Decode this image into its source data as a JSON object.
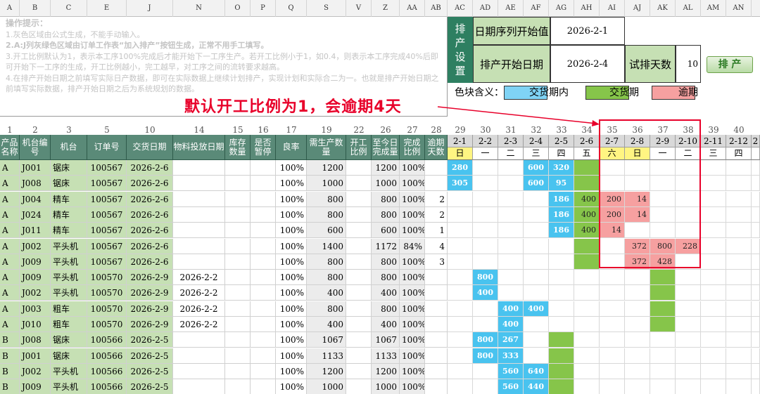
{
  "colors": {
    "blue": "#49c3ef",
    "green": "#86c54a",
    "red": "#f6a0a0",
    "yellow": "#fff582",
    "header_green": "#5a8a78"
  },
  "column_letters": [
    "A",
    "B",
    "C",
    "E",
    "J",
    "N",
    "O",
    "P",
    "Q",
    "S",
    "V",
    "Z",
    "AA",
    "AB",
    "AC",
    "AD",
    "AE",
    "AF",
    "AG",
    "AH",
    "AI",
    "AJ",
    "AK",
    "AL",
    "AM",
    "AN"
  ],
  "tips": {
    "title": "操作提示：",
    "l1": "1.灰色区域由公式生成，不能手动输入。",
    "l2": "2.A:J列灰绿色区域由订单工作表“加入排产”按钮生成，正常不用手工填写。",
    "l3": "3.开工比例默认为1，表示本工序100%完成后才能开始下一工序生产。若开工比例小于1，如0.4，则表示本工序完成40%后即可开始下一工序的生成，开工比例越小，完工越早，对工序之间的流转要求越高。",
    "l4": "4.在排产开始日期之前填写实际日产数据，即可在实际数据上继续计划排产，实现计划和实际合二为一。也就是排产开始日期之前填写实际数据，排产开始日期之后为系统规划的数据。"
  },
  "annotation": "默认开工比例为1，会逾期4天",
  "setup": {
    "label": "排产设置",
    "seq_start_label": "日期序列开始值",
    "seq_start_value": "2026-2-1",
    "sched_start_label": "排产开始日期",
    "sched_start_value": "2026-2-4",
    "trial_days_label": "试排天数",
    "trial_days_value": "10",
    "run_button": "排 产"
  },
  "legend": {
    "label": "色块含义：",
    "in_period": "交货期内",
    "due": "交货期",
    "overdue": "逾期"
  },
  "col_numbers": [
    "1",
    "2",
    "3",
    "5",
    "10",
    "14",
    "15",
    "16",
    "17",
    "19",
    "22",
    "26",
    "27",
    "28",
    "29",
    "30",
    "31",
    "32",
    "33",
    "34",
    "35",
    "36",
    "37",
    "38",
    "39",
    "40"
  ],
  "headers": {
    "product": "产品名称",
    "machine_no": "机台编号",
    "machine": "机台",
    "order": "订单号",
    "due_date": "交货日期",
    "material": "物料投放日期",
    "stock": "库存数量",
    "pause": "是否暂停",
    "yield": "良率",
    "need": "需生产数量",
    "ratio": "开工比例",
    "done": "至今日完成量",
    "done_pct": "完成比例",
    "overdue": "逾期天数"
  },
  "dates": [
    "2-1",
    "2-2",
    "2-3",
    "2-4",
    "2-5",
    "2-6",
    "2-7",
    "2-8",
    "2-9",
    "2-10",
    "2-11",
    "2-12",
    "2"
  ],
  "weekdays": [
    "日",
    "一",
    "二",
    "三",
    "四",
    "五",
    "六",
    "日",
    "一",
    "二",
    "三",
    "四",
    ""
  ],
  "rows": [
    {
      "p": "A",
      "no": "J001",
      "m": "锯床",
      "o": "100567",
      "d": "2026-2-6",
      "mat": "",
      "y": "100%",
      "n": "1200",
      "done": "1200",
      "pct": "100%",
      "od": ""
    },
    {
      "p": "A",
      "no": "J008",
      "m": "锯床",
      "o": "100567",
      "d": "2026-2-6",
      "mat": "",
      "y": "100%",
      "n": "1000",
      "done": "1000",
      "pct": "100%",
      "od": ""
    },
    {
      "p": "A",
      "no": "J004",
      "m": "精车",
      "o": "100567",
      "d": "2026-2-6",
      "mat": "",
      "y": "100%",
      "n": "800",
      "done": "800",
      "pct": "100%",
      "od": "2"
    },
    {
      "p": "A",
      "no": "J024",
      "m": "精车",
      "o": "100567",
      "d": "2026-2-6",
      "mat": "",
      "y": "100%",
      "n": "800",
      "done": "800",
      "pct": "100%",
      "od": "2"
    },
    {
      "p": "A",
      "no": "J011",
      "m": "精车",
      "o": "100567",
      "d": "2026-2-6",
      "mat": "",
      "y": "100%",
      "n": "600",
      "done": "600",
      "pct": "100%",
      "od": "1"
    },
    {
      "p": "A",
      "no": "J002",
      "m": "平头机",
      "o": "100567",
      "d": "2026-2-6",
      "mat": "",
      "y": "100%",
      "n": "1400",
      "done": "1172",
      "pct": "84%",
      "od": "4"
    },
    {
      "p": "A",
      "no": "J009",
      "m": "平头机",
      "o": "100567",
      "d": "2026-2-6",
      "mat": "",
      "y": "100%",
      "n": "800",
      "done": "800",
      "pct": "100%",
      "od": "3"
    },
    {
      "p": "A",
      "no": "J009",
      "m": "平头机",
      "o": "100570",
      "d": "2026-2-9",
      "mat": "2026-2-2",
      "y": "100%",
      "n": "800",
      "done": "800",
      "pct": "100%",
      "od": ""
    },
    {
      "p": "A",
      "no": "J002",
      "m": "平头机",
      "o": "100570",
      "d": "2026-2-9",
      "mat": "2026-2-2",
      "y": "100%",
      "n": "400",
      "done": "400",
      "pct": "100%",
      "od": ""
    },
    {
      "p": "A",
      "no": "J003",
      "m": "粗车",
      "o": "100570",
      "d": "2026-2-9",
      "mat": "2026-2-2",
      "y": "100%",
      "n": "800",
      "done": "800",
      "pct": "100%",
      "od": ""
    },
    {
      "p": "A",
      "no": "J010",
      "m": "粗车",
      "o": "100570",
      "d": "2026-2-9",
      "mat": "2026-2-2",
      "y": "100%",
      "n": "400",
      "done": "400",
      "pct": "100%",
      "od": ""
    },
    {
      "p": "B",
      "no": "J008",
      "m": "锯床",
      "o": "100566",
      "d": "2026-2-5",
      "mat": "",
      "y": "100%",
      "n": "1067",
      "done": "1067",
      "pct": "100%",
      "od": ""
    },
    {
      "p": "B",
      "no": "J001",
      "m": "锯床",
      "o": "100566",
      "d": "2026-2-5",
      "mat": "",
      "y": "100%",
      "n": "1133",
      "done": "1133",
      "pct": "100%",
      "od": ""
    },
    {
      "p": "B",
      "no": "J002",
      "m": "平头机",
      "o": "100566",
      "d": "2026-2-5",
      "mat": "",
      "y": "100%",
      "n": "1200",
      "done": "1200",
      "pct": "100%",
      "od": ""
    },
    {
      "p": "B",
      "no": "J009",
      "m": "平头机",
      "o": "100566",
      "d": "2026-2-5",
      "mat": "",
      "y": "100%",
      "n": "1000",
      "done": "1000",
      "pct": "100%",
      "od": ""
    }
  ],
  "gantt": [
    [
      [
        "b",
        0,
        "280"
      ],
      [
        "b",
        3,
        "600"
      ],
      [
        "b",
        4,
        "320"
      ],
      [
        "g",
        5,
        ""
      ]
    ],
    [
      [
        "b",
        0,
        "305"
      ],
      [
        "b",
        3,
        "600"
      ],
      [
        "b",
        4,
        "95"
      ],
      [
        "g",
        5,
        ""
      ]
    ],
    [
      [
        "b",
        4,
        "186"
      ],
      [
        "g",
        5,
        "400"
      ],
      [
        "r",
        6,
        "200"
      ],
      [
        "r",
        7,
        "14"
      ]
    ],
    [
      [
        "b",
        4,
        "186"
      ],
      [
        "g",
        5,
        "400"
      ],
      [
        "r",
        6,
        "200"
      ],
      [
        "r",
        7,
        "14"
      ]
    ],
    [
      [
        "b",
        4,
        "186"
      ],
      [
        "g",
        5,
        "400"
      ],
      [
        "r",
        6,
        "14"
      ]
    ],
    [
      [
        "g",
        5,
        ""
      ],
      [
        "r",
        7,
        "372"
      ],
      [
        "r",
        8,
        "800"
      ],
      [
        "r",
        9,
        "228"
      ]
    ],
    [
      [
        "g",
        5,
        ""
      ],
      [
        "r",
        7,
        "372"
      ],
      [
        "r",
        8,
        "428"
      ]
    ],
    [
      [
        "b",
        1,
        "800"
      ],
      [
        "g",
        8,
        ""
      ]
    ],
    [
      [
        "b",
        1,
        "400"
      ],
      [
        "g",
        8,
        ""
      ]
    ],
    [
      [
        "b",
        2,
        "400"
      ],
      [
        "b",
        3,
        "400"
      ],
      [
        "g",
        8,
        ""
      ]
    ],
    [
      [
        "b",
        2,
        "400"
      ],
      [
        "g",
        8,
        ""
      ]
    ],
    [
      [
        "b",
        1,
        "800"
      ],
      [
        "b",
        2,
        "267"
      ],
      [
        "g",
        4,
        ""
      ]
    ],
    [
      [
        "b",
        1,
        "800"
      ],
      [
        "b",
        2,
        "333"
      ],
      [
        "g",
        4,
        ""
      ]
    ],
    [
      [
        "b",
        2,
        "560"
      ],
      [
        "b",
        3,
        "640"
      ],
      [
        "g",
        4,
        ""
      ]
    ],
    [
      [
        "b",
        2,
        "560"
      ],
      [
        "b",
        3,
        "440"
      ],
      [
        "g",
        4,
        ""
      ]
    ]
  ]
}
